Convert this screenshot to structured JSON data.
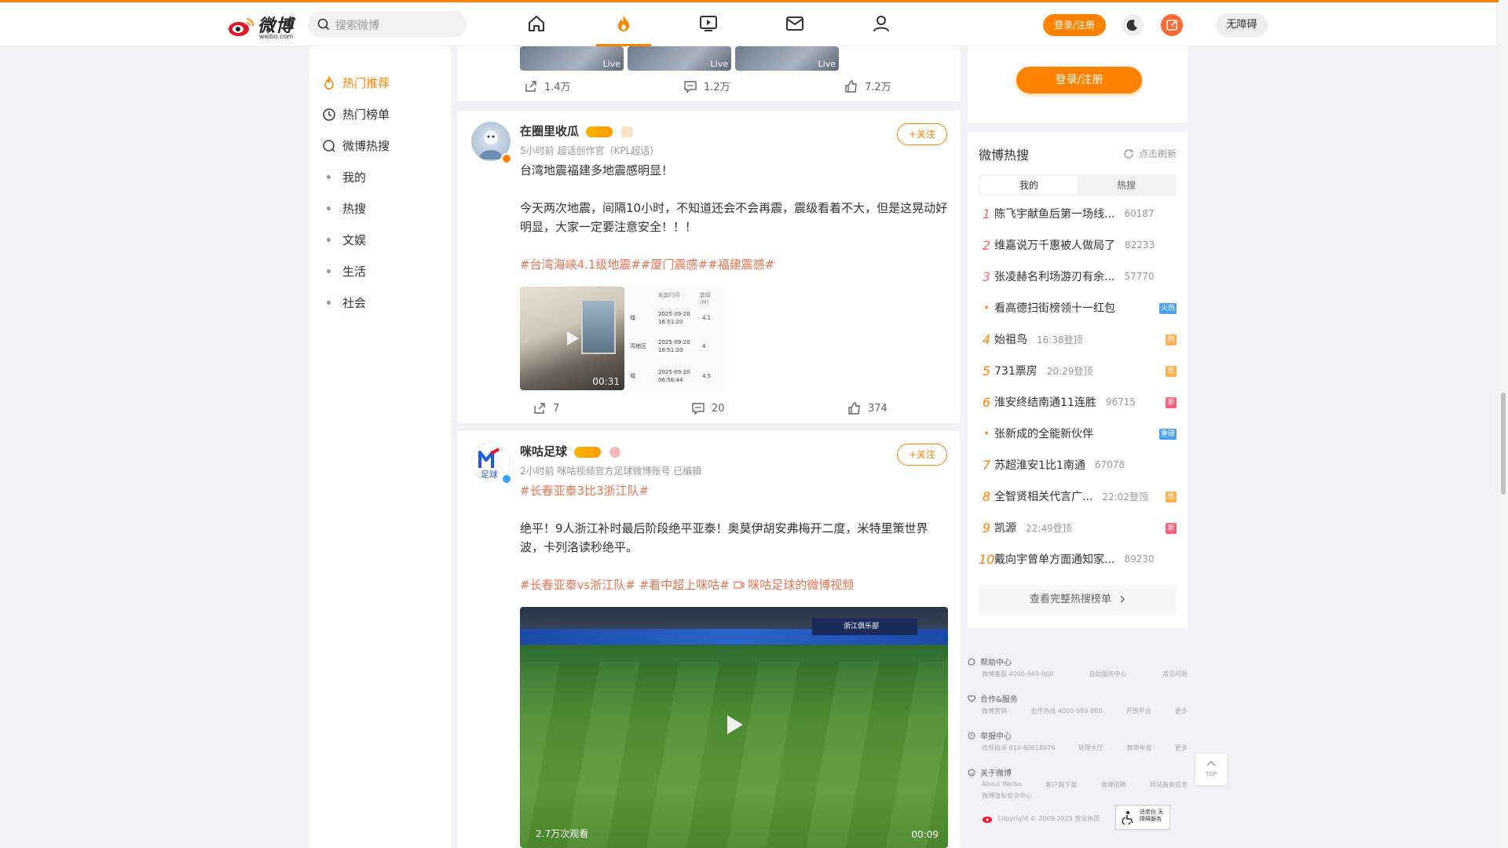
{
  "header": {
    "logo_text": "微博",
    "logo_sub": "weibo.com",
    "search_placeholder": "搜索微博",
    "login_label": "登录/注册",
    "a11y_label": "无障碍"
  },
  "left_nav": {
    "items": [
      {
        "label": "热门推荐",
        "icon": "flame-icon",
        "active": true
      },
      {
        "label": "热门榜单",
        "icon": "clock-icon",
        "active": false
      },
      {
        "label": "微博热搜",
        "icon": "search-icon",
        "active": false
      },
      {
        "label": "我的",
        "icon": "dot",
        "active": false
      },
      {
        "label": "热搜",
        "icon": "dot",
        "active": false
      },
      {
        "label": "文娱",
        "icon": "dot",
        "active": false
      },
      {
        "label": "生活",
        "icon": "dot",
        "active": false
      },
      {
        "label": "社会",
        "icon": "dot",
        "active": false
      }
    ]
  },
  "feed": {
    "post0": {
      "thumbs": [
        "Live",
        "Live",
        "Live"
      ],
      "repost": "1.4万",
      "comment": "1.2万",
      "like": "7.2万"
    },
    "post1": {
      "username": "在圈里收瓜",
      "meta": "5小时前 超话创作官（KPL超话）",
      "follow": "+关注",
      "text1": "台湾地震福建多地震感明显！",
      "text2": "今天两次地震，间隔10小时，不知道还会不会再震，震级看着不大，但是这晃动好明显，大家一定要注意安全！！！",
      "tags": "#台湾海峡4.1级地震##厦门震感##福建震感#",
      "video_duration": "00:31",
      "table": {
        "headers": [
          "",
          "发震时间",
          "震级(M)"
        ],
        "rows": [
          [
            "域",
            "2025-09-20 16:51:20",
            "4.1"
          ],
          [
            "湾地区",
            "2025-09-20 16:51:20",
            "4"
          ],
          [
            "域",
            "2025-09-20 06:56:44",
            "4.5"
          ]
        ]
      },
      "repost": "7",
      "comment": "20",
      "like": "374"
    },
    "post2": {
      "username": "咪咕足球",
      "meta": "2小时前 咪咕视频官方足球微博账号 已编辑",
      "follow": "+关注",
      "tag_top": "#长春亚泰3比3浙江队#",
      "text": "绝平！9人浙江补时最后阶段绝平亚泰！奥莫伊胡安弗梅开二度，米特里策世界波，卡列洛读秒绝平。",
      "tags": "#长春亚泰vs浙江队# #看中超上咪咕# ",
      "video_link": "咪咕足球的微博视频",
      "views": "2.7万次观看",
      "duration": "00:09",
      "scoreboard": "浙江俱乐部"
    }
  },
  "right": {
    "login_button": "登录/注册",
    "hot": {
      "title": "微博热搜",
      "refresh": "点击刷新",
      "tab_mine": "我的",
      "tab_hot": "热搜",
      "items": [
        {
          "rank": "1",
          "word": "陈飞宇献鱼后第一场线...",
          "num": "60187",
          "flag": ""
        },
        {
          "rank": "2",
          "word": "维嘉说万千惠被人做局了",
          "num": "82233",
          "flag": ""
        },
        {
          "rank": "3",
          "word": "张凌赫名利场游刃有余...",
          "num": "57770",
          "flag": ""
        },
        {
          "rank": "•",
          "word": "看高德扫街榜领十一红包",
          "num": "",
          "flag": "火热"
        },
        {
          "rank": "4",
          "word": "始祖鸟",
          "num": "16:38登顶",
          "flag": "热"
        },
        {
          "rank": "5",
          "word": "731票房",
          "num": "20:29登顶",
          "flag": "热"
        },
        {
          "rank": "6",
          "word": "淮安终结南通11连胜",
          "num": "96715",
          "flag": "新"
        },
        {
          "rank": "•",
          "word": "张新成的全能新伙伴",
          "num": "",
          "flag": "重磅"
        },
        {
          "rank": "7",
          "word": "苏超淮安1比1南通",
          "num": "67078",
          "flag": ""
        },
        {
          "rank": "8",
          "word": "全智贤相关代言广...",
          "num": "22:02登顶",
          "flag": "热"
        },
        {
          "rank": "9",
          "word": "凯源",
          "num": "22:49登顶",
          "flag": "新"
        },
        {
          "rank": "10",
          "word": "戴向宇曾单方面通知家...",
          "num": "89230",
          "flag": ""
        }
      ],
      "more": "查看完整热搜榜单"
    },
    "footer": {
      "help": "帮助中心",
      "help_links": [
        "微博客服 4000-960-960",
        "自助服务中心",
        "常见问题"
      ],
      "coop": "合作&服务",
      "coop_links": [
        "微博营销",
        "合作热线 4000-980-980",
        "开放平台",
        "更多"
      ],
      "report": "举报中心",
      "report_links": [
        "违规投诉 010-60618076",
        "处理大厅",
        "舞弊举报",
        "更多"
      ],
      "about": "关于微博",
      "about_links": [
        "About Weibo",
        "客户端下载",
        "微博招聘",
        "网站备案信息"
      ],
      "about_line2": "微博隐私安全中心",
      "copyright": "Copyright © 2009-2025 营业执照",
      "badge": "适老化 无障碍服务"
    },
    "totop": "TOP"
  },
  "colors": {
    "accent": "#ff8200",
    "tag": "#eb7350"
  }
}
